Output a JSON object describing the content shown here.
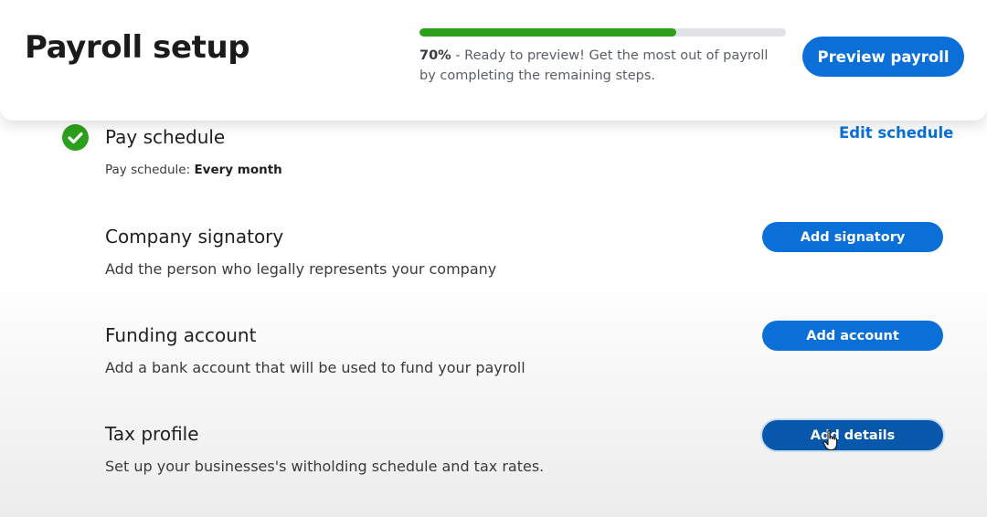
{
  "header": {
    "title": "Payroll setup",
    "progress": {
      "percent": 70,
      "percent_label": "70%",
      "message": " - Ready to preview! Get the most out of payroll by completing the remaining steps."
    },
    "preview_button_label": "Preview payroll"
  },
  "steps": [
    {
      "title": "Pay schedule",
      "description_prefix": "Pay schedule: ",
      "description_value": "Every month",
      "completed": true,
      "action_label": "Edit schedule",
      "icon": "check-circle-icon"
    },
    {
      "title": "Company signatory",
      "description": "Add the person who legally represents your company",
      "action_label": "Add signatory"
    },
    {
      "title": "Funding account",
      "description": "Add a bank account that will be used to fund your payroll",
      "action_label": "Add account"
    },
    {
      "title": "Tax profile",
      "description": "Set up your businesses's witholding schedule and tax rates.",
      "action_label": "Add details"
    }
  ],
  "colors": {
    "primary_blue": "#0a70d8",
    "primary_blue_hover": "#0757ab",
    "progress_green": "#2ca01c",
    "check_green": "#2ca01c"
  }
}
